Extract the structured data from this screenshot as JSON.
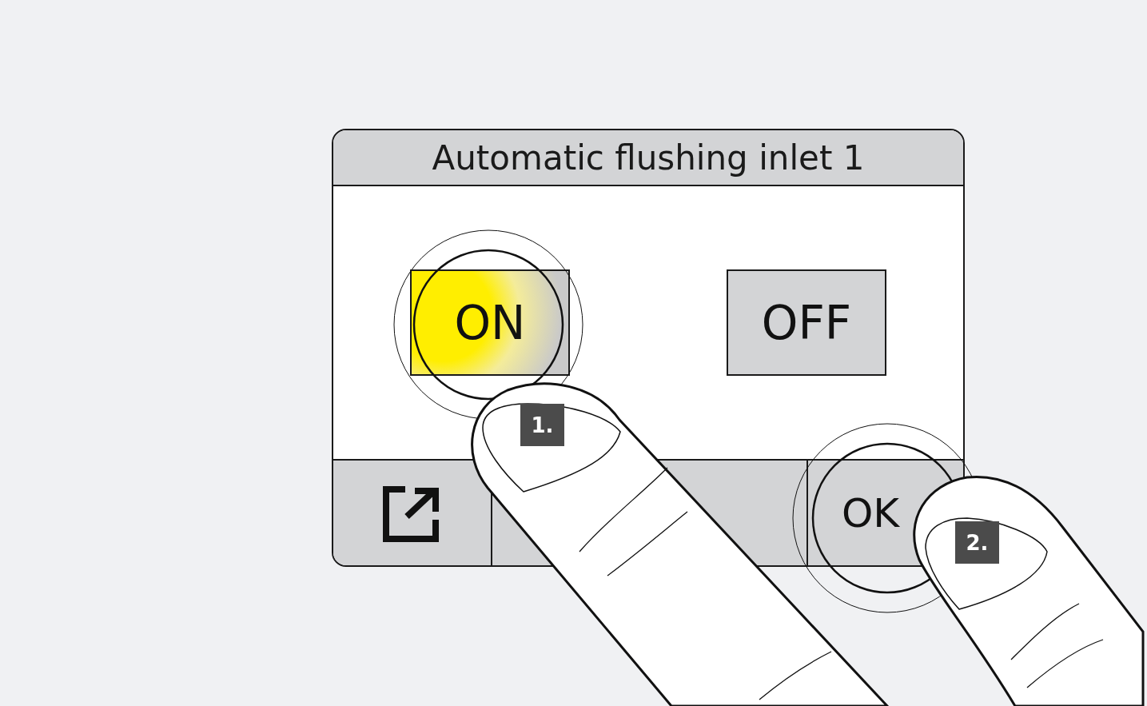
{
  "screen": {
    "title": "Automatic flushing inlet 1",
    "options": [
      {
        "label": "ON",
        "selected": true
      },
      {
        "label": "OFF",
        "selected": false
      }
    ],
    "confirm_label": "OK"
  },
  "steps": [
    "1.",
    "2."
  ]
}
